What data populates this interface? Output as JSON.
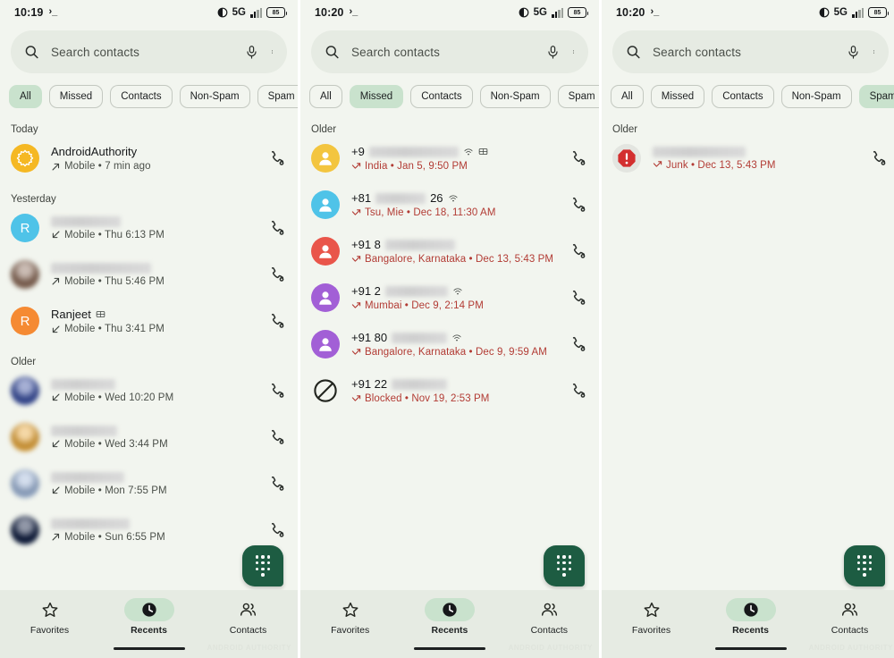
{
  "search": {
    "placeholder": "Search contacts"
  },
  "chips": [
    "All",
    "Missed",
    "Contacts",
    "Non-Spam",
    "Spam"
  ],
  "bottom_nav": [
    {
      "label": "Favorites",
      "icon": "star-icon",
      "active": false
    },
    {
      "label": "Recents",
      "icon": "clock-icon",
      "active": true
    },
    {
      "label": "Contacts",
      "icon": "people-icon",
      "active": false
    }
  ],
  "watermark": "ANDROID AUTHORITY",
  "colors": {
    "background": "#f2f5ef",
    "surface": "#e6ebe3",
    "chip_selected": "#c9e2cd",
    "fab": "#1d5c42",
    "missed_red": "#b23b34",
    "spam_red": "#d32f2f"
  },
  "panels": [
    {
      "id": "panel-all",
      "status": {
        "time": "10:19",
        "network": "5G",
        "battery": "85"
      },
      "active_chip": "All",
      "sections": [
        {
          "header": "Today",
          "calls": [
            {
              "name": "AndroidAuthority",
              "name_blurred": false,
              "avatar": {
                "type": "logo-starburst",
                "color": "#f5b823"
              },
              "direction": "outgoing",
              "detail": "Mobile • 7 min ago",
              "badges": []
            }
          ]
        },
        {
          "header": "Yesterday",
          "calls": [
            {
              "name": "",
              "name_blurred": true,
              "blur_width": 78,
              "avatar": {
                "type": "letter",
                "letter": "R",
                "color": "#4fc3e8"
              },
              "direction": "incoming",
              "detail": "Mobile • Thu 6:13 PM",
              "badges": []
            },
            {
              "name": "",
              "name_blurred": true,
              "blur_width": 112,
              "avatar": {
                "type": "photo",
                "color": "#8a6a58"
              },
              "direction": "outgoing",
              "detail": "Mobile • Thu 5:46 PM",
              "badges": []
            },
            {
              "name": "Ranjeet",
              "name_blurred": false,
              "avatar": {
                "type": "letter",
                "letter": "R",
                "color": "#f58a33"
              },
              "direction": "incoming",
              "detail": "Mobile • Thu 3:41 PM",
              "badges": [
                "video-call-icon"
              ]
            }
          ]
        },
        {
          "header": "Older",
          "calls": [
            {
              "name": "",
              "name_blurred": true,
              "blur_width": 72,
              "avatar": {
                "type": "photo",
                "color": "#3a4fa0"
              },
              "direction": "incoming",
              "detail": "Mobile • Wed 10:20 PM",
              "badges": []
            },
            {
              "name": "",
              "name_blurred": true,
              "blur_width": 74,
              "avatar": {
                "type": "photo",
                "color": "#e8a83c"
              },
              "direction": "incoming",
              "detail": "Mobile • Wed 3:44 PM",
              "badges": []
            },
            {
              "name": "",
              "name_blurred": true,
              "blur_width": 82,
              "avatar": {
                "type": "photo",
                "color": "#9fb6d8"
              },
              "direction": "incoming",
              "detail": "Mobile • Mon 7:55 PM",
              "badges": []
            },
            {
              "name": "",
              "name_blurred": true,
              "blur_width": 88,
              "avatar": {
                "type": "photo",
                "color": "#0d1b3e"
              },
              "direction": "outgoing",
              "detail": "Mobile • Sun 6:55 PM",
              "badges": []
            }
          ]
        }
      ]
    },
    {
      "id": "panel-missed",
      "status": {
        "time": "10:20",
        "network": "5G",
        "battery": "85"
      },
      "active_chip": "Missed",
      "sections": [
        {
          "header": "Older",
          "calls": [
            {
              "name": "+9",
              "name_blurred": true,
              "blur_width": 100,
              "avatar": {
                "type": "person",
                "color": "#f3c53f"
              },
              "direction": "missed",
              "detail": "India • Jan 5, 9:50 PM",
              "badges": [
                "wifi-call-icon",
                "video-call-icon"
              ]
            },
            {
              "name": "+81",
              "name_suffix": "26",
              "name_blurred": true,
              "blur_width": 56,
              "avatar": {
                "type": "person",
                "color": "#4fc3e8"
              },
              "direction": "missed",
              "detail": "Tsu, Mie • Dec 18, 11:30 AM",
              "badges": [
                "wifi-call-icon"
              ]
            },
            {
              "name": "+91 8",
              "name_blurred": true,
              "blur_width": 78,
              "avatar": {
                "type": "person",
                "color": "#e9554a"
              },
              "direction": "missed",
              "detail": "Bangalore, Karnataka • Dec 13, 5:43 PM",
              "badges": []
            },
            {
              "name": "+91 2",
              "name_blurred": true,
              "blur_width": 70,
              "avatar": {
                "type": "person",
                "color": "#a25fd6"
              },
              "direction": "missed",
              "detail": "Mumbai • Dec 9, 2:14 PM",
              "badges": [
                "wifi-call-icon"
              ]
            },
            {
              "name": "+91 80",
              "name_blurred": true,
              "blur_width": 62,
              "avatar": {
                "type": "person",
                "color": "#a25fd6"
              },
              "direction": "missed",
              "detail": "Bangalore, Karnataka • Dec 9, 9:59 AM",
              "badges": [
                "wifi-call-icon"
              ]
            },
            {
              "name": "+91 22",
              "name_blurred": true,
              "blur_width": 62,
              "avatar": {
                "type": "blocked"
              },
              "direction": "missed",
              "detail": "Blocked • Nov 19, 2:53 PM",
              "badges": []
            }
          ]
        }
      ]
    },
    {
      "id": "panel-spam",
      "status": {
        "time": "10:20",
        "network": "5G",
        "battery": "85"
      },
      "active_chip": "Spam",
      "sections": [
        {
          "header": "Older",
          "calls": [
            {
              "name": "",
              "name_blurred": true,
              "blur_width": 104,
              "avatar": {
                "type": "spam"
              },
              "direction": "missed",
              "detail": "Junk • Dec 13, 5:43 PM",
              "badges": []
            }
          ]
        }
      ]
    }
  ]
}
